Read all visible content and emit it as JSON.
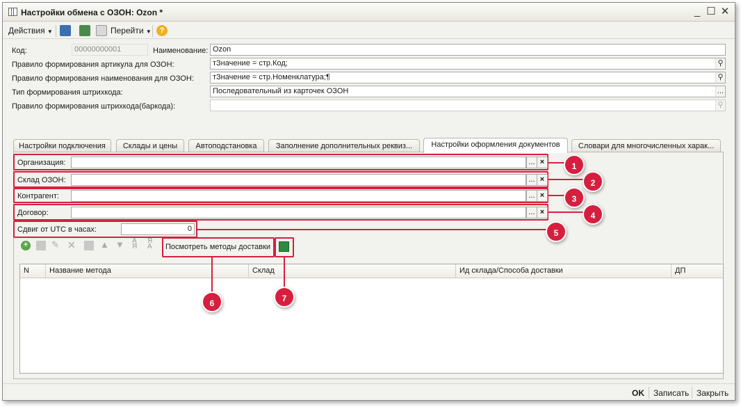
{
  "window": {
    "title": "Настройки обмена с ОЗОН: Ozon *",
    "min": "_",
    "max": "☐",
    "close": "✕"
  },
  "toolbar": {
    "actions_label": "Действия",
    "goto_label": "Перейти",
    "help": "?"
  },
  "form": {
    "code_label": "Код:",
    "code_value": "00000000001",
    "name_label": "Наименование:",
    "name_value": "Ozon",
    "article_rule_label": "Правило формирования артикула для ОЗОН:",
    "article_rule_value": "тЗначение =  стр.Код;",
    "name_rule_label": "Правило формирования наименования для ОЗОН:",
    "name_rule_value": "тЗначение =  стр.Номенклатура;¶",
    "barcode_type_label": "Тип формирования штрихкода:",
    "barcode_type_value": "Последовательный из карточек ОЗОН",
    "barcode_rule_label": "Правило формирования штрихкода(баркода):",
    "barcode_rule_value": ""
  },
  "tabs": [
    {
      "label": "Настройки подключения"
    },
    {
      "label": "Склады и цены"
    },
    {
      "label": "Автоподстановка"
    },
    {
      "label": "Заполнение дополнительных реквиз..."
    },
    {
      "label": "Настройки оформления документов"
    },
    {
      "label": "Словари для многочисленных харак..."
    }
  ],
  "panel": {
    "org_label": "Организация:",
    "org_value": "",
    "warehouse_label": "Склад ОЗОН:",
    "warehouse_value": "",
    "contractor_label": "Контрагент:",
    "contractor_value": "",
    "contract_label": "Договор:",
    "contract_value": "",
    "utc_label": "Сдвиг от UTC в часах:",
    "utc_value": "0",
    "delivery_button": "Посмотреть методы доставки"
  },
  "table": {
    "columns": [
      "N",
      "Название метода",
      "Склад",
      "Ид склада/Способа доставки",
      "ДП"
    ]
  },
  "markers": [
    "1",
    "2",
    "3",
    "4",
    "5",
    "6",
    "7"
  ],
  "footer": {
    "ok": "OK",
    "save": "Записать",
    "close": "Закрыть"
  },
  "colors": {
    "accent": "#d61f3f",
    "background": "#f2f2ee"
  }
}
